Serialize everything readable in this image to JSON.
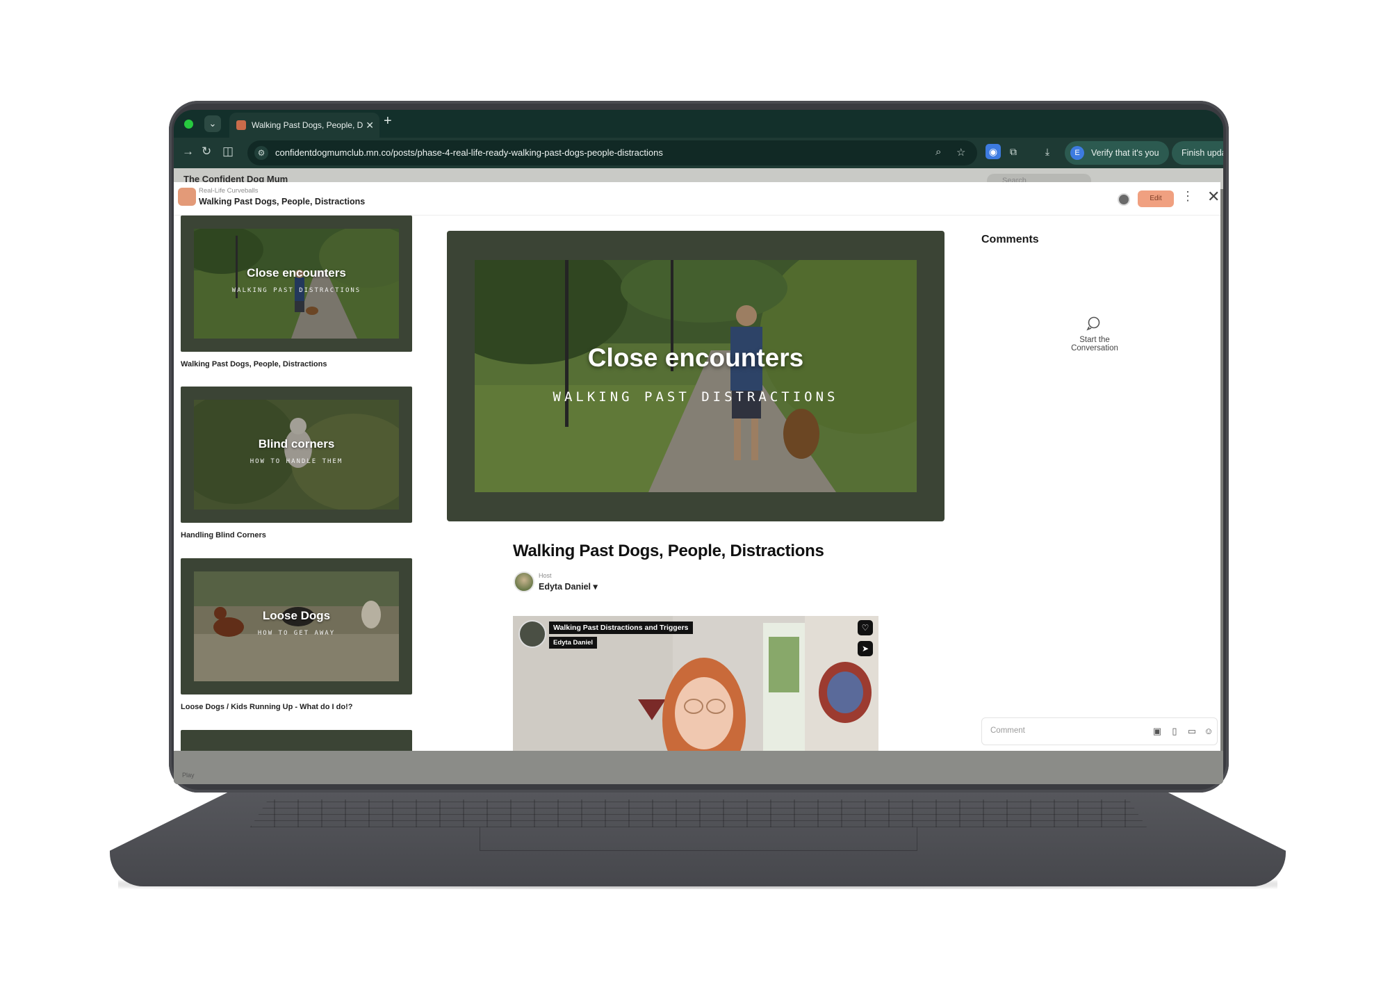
{
  "browser": {
    "tab_title": "Walking Past Dogs, People, D",
    "url": "confidentdogmumclub.mn.co/posts/phase-4-real-life-ready-walking-past-dogs-people-distractions",
    "verify_label": "Verify that it's you",
    "update_label": "Finish updat"
  },
  "background_site": {
    "title": "The Confident Dog Mum",
    "search_placeholder": "Search"
  },
  "modal": {
    "breadcrumb": "Real-Life Curveballs",
    "title": "Walking Past Dogs, People, Distractions",
    "edit_label": "Edit"
  },
  "lessons": [
    {
      "overlay_title": "Close encounters",
      "overlay_subtitle": "WALKING PAST DISTRACTIONS",
      "caption": "Walking Past Dogs, People, Distractions"
    },
    {
      "overlay_title": "Blind corners",
      "overlay_subtitle": "HOW TO HANDLE THEM",
      "caption": "Handling Blind Corners"
    },
    {
      "overlay_title": "Loose Dogs",
      "overlay_subtitle": "HOW TO GET AWAY",
      "caption": "Loose Dogs / Kids Running Up - What do I do!?"
    }
  ],
  "hero": {
    "title": "Close encounters",
    "subtitle": "WALKING PAST DISTRACTIONS"
  },
  "post": {
    "title": "Walking Past Dogs, People, Distractions",
    "host_label": "Host",
    "host_name": "Edyta Daniel ▾"
  },
  "video": {
    "tag_title": "Walking Past Distractions and Triggers",
    "tag_name": "Edyta Daniel"
  },
  "comments": {
    "heading": "Comments",
    "empty_label": "Start the Conversation",
    "input_placeholder": "Comment"
  },
  "footer": {
    "play_label": "Play"
  },
  "colors": {
    "browser_bg": "#1e3a34",
    "thumb_frame": "#3b4435",
    "edit_button": "#f0a080"
  }
}
